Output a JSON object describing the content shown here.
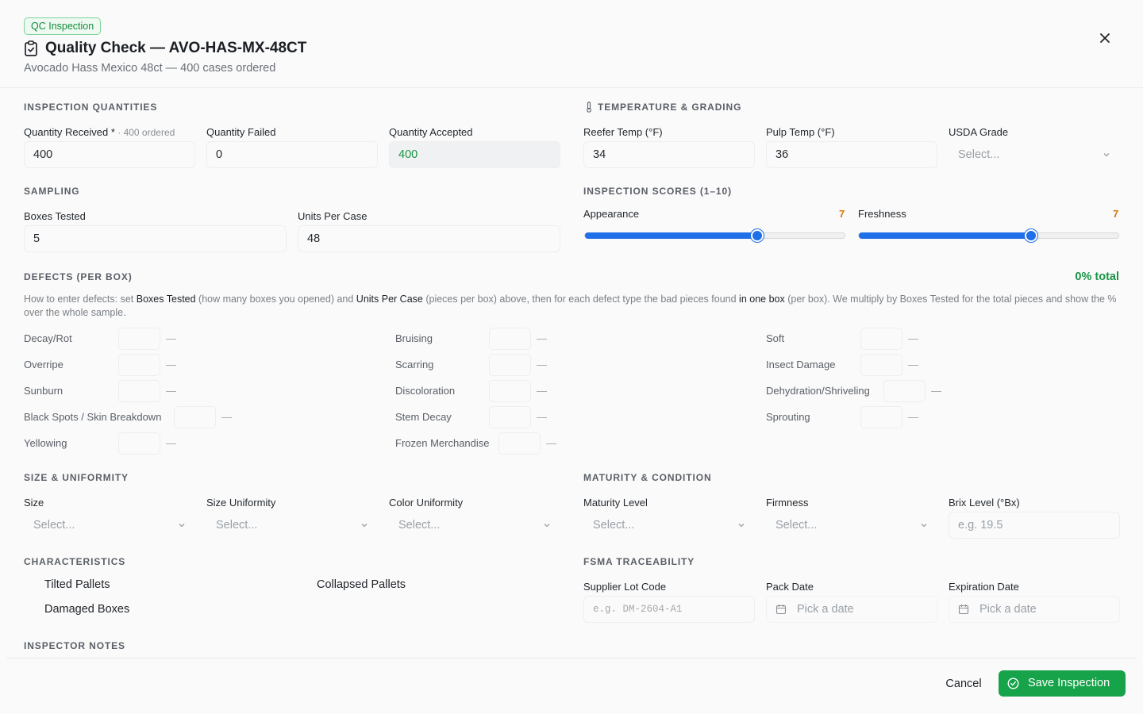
{
  "header": {
    "badge": "QC Inspection",
    "title": "Quality Check — AVO-HAS-MX-48CT",
    "subtitle": "Avocado Hass Mexico 48ct — 400 cases ordered"
  },
  "quantities": {
    "heading": "INSPECTION QUANTITIES",
    "received_label": "Quantity Received *",
    "received_hint": " · 400 ordered",
    "received_value": "400",
    "failed_label": "Quantity Failed",
    "failed_value": "0",
    "accepted_label": "Quantity Accepted",
    "accepted_value": "400"
  },
  "temperature": {
    "heading": "TEMPERATURE & GRADING",
    "reefer_label": "Reefer Temp (°F)",
    "reefer_value": "34",
    "pulp_label": "Pulp Temp (°F)",
    "pulp_value": "36",
    "grade_label": "USDA Grade",
    "grade_placeholder": "Select..."
  },
  "sampling": {
    "heading": "SAMPLING",
    "boxes_label": "Boxes Tested",
    "boxes_value": "5",
    "units_label": "Units Per Case",
    "units_value": "48"
  },
  "scores": {
    "heading": "INSPECTION SCORES (1–10)",
    "appearance_label": "Appearance",
    "appearance_value": "7",
    "freshness_label": "Freshness",
    "freshness_value": "7",
    "scale_min": 1,
    "scale_max": 10
  },
  "defects": {
    "heading": "DEFECTS (PER BOX)",
    "total": "0% total",
    "help_1": "How to enter defects: set ",
    "help_b1": "Boxes Tested",
    "help_2": " (how many boxes you opened) and ",
    "help_b2": "Units Per Case",
    "help_3": " (pieces per box) above, then for each defect type the bad pieces found ",
    "help_b3": "in one box",
    "help_4": " (per box). We multiply by Boxes Tested for the total pieces and show the % over the whole sample.",
    "dash": "—",
    "col1": [
      "Decay/Rot",
      "Overripe",
      "Sunburn",
      "Black Spots / Skin Breakdown",
      "Yellowing"
    ],
    "col2": [
      "Bruising",
      "Scarring",
      "Discoloration",
      "Stem Decay",
      "Frozen Merchandise"
    ],
    "col3": [
      "Soft",
      "Insect Damage",
      "Dehydration/Shriveling",
      "Sprouting"
    ]
  },
  "size": {
    "heading": "SIZE & UNIFORMITY",
    "size_label": "Size",
    "size_uniformity_label": "Size Uniformity",
    "color_uniformity_label": "Color Uniformity",
    "placeholder": "Select..."
  },
  "maturity": {
    "heading": "MATURITY & CONDITION",
    "maturity_label": "Maturity Level",
    "firmness_label": "Firmness",
    "brix_label": "Brix Level (°Bx)",
    "placeholder": "Select...",
    "brix_placeholder": "e.g. 19.5"
  },
  "characteristics": {
    "heading": "CHARACTERISTICS",
    "tilted": "Tilted Pallets",
    "collapsed": "Collapsed Pallets",
    "damaged": "Damaged Boxes"
  },
  "fsma": {
    "heading": "FSMA TRACEABILITY",
    "lot_label": "Supplier Lot Code",
    "lot_placeholder": "e.g. DM-2604-A1",
    "pack_label": "Pack Date",
    "expiration_label": "Expiration Date",
    "date_placeholder": "Pick a date"
  },
  "notes": {
    "heading": "INSPECTOR NOTES"
  },
  "footer": {
    "cancel": "Cancel",
    "save": "Save Inspection"
  },
  "colors": {
    "accent_green": "#16a34a",
    "slider_blue": "#1e6fe8",
    "score_orange": "#d97706"
  }
}
